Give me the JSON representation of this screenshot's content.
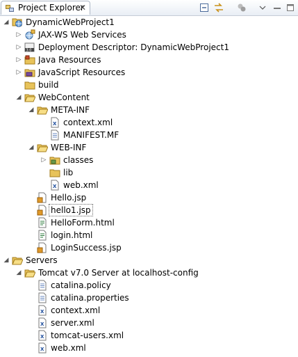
{
  "view": {
    "title": "Project Explorer",
    "close_glyph": "✕",
    "toolbar": [
      {
        "icon": "collapse-all-icon"
      },
      {
        "icon": "link-with-editor-icon"
      },
      {
        "icon": "view-menu-icon"
      },
      {
        "icon": "minimize-icon"
      },
      {
        "icon": "maximize-icon"
      }
    ]
  },
  "tree": [
    {
      "label": "DynamicWebProject1",
      "icon": "web-project-icon",
      "depth": 0,
      "expanded": true
    },
    {
      "label": "JAX-WS Web Services",
      "icon": "web-services-icon",
      "depth": 1,
      "expanded": false
    },
    {
      "label": "Deployment Descriptor: DynamicWebProject1",
      "icon": "deployment-descriptor-icon",
      "depth": 1,
      "expanded": false
    },
    {
      "label": "Java Resources",
      "icon": "java-resources-icon",
      "depth": 1,
      "expanded": false
    },
    {
      "label": "JavaScript Resources",
      "icon": "javascript-resources-icon",
      "depth": 1,
      "expanded": false
    },
    {
      "label": "build",
      "icon": "folder-icon",
      "depth": 1,
      "expanded": null
    },
    {
      "label": "WebContent",
      "icon": "open-folder-icon",
      "depth": 1,
      "expanded": true
    },
    {
      "label": "META-INF",
      "icon": "open-folder-icon",
      "depth": 2,
      "expanded": true
    },
    {
      "label": "context.xml",
      "icon": "xml-file-icon",
      "depth": 3,
      "expanded": null
    },
    {
      "label": "MANIFEST.MF",
      "icon": "text-file-icon",
      "depth": 3,
      "expanded": null
    },
    {
      "label": "WEB-INF",
      "icon": "open-folder-icon",
      "depth": 2,
      "expanded": true
    },
    {
      "label": "classes",
      "icon": "package-folder-icon",
      "depth": 3,
      "expanded": false
    },
    {
      "label": "lib",
      "icon": "folder-icon",
      "depth": 3,
      "expanded": null
    },
    {
      "label": "web.xml",
      "icon": "xml-file-icon",
      "depth": 3,
      "expanded": null
    },
    {
      "label": "Hello.jsp",
      "icon": "jsp-file-icon",
      "depth": 2,
      "expanded": null
    },
    {
      "label": "hello1.jsp",
      "icon": "jsp-file-icon",
      "depth": 2,
      "expanded": null,
      "selected": true
    },
    {
      "label": "HelloForm.html",
      "icon": "html-file-icon",
      "depth": 2,
      "expanded": null
    },
    {
      "label": "login.html",
      "icon": "html-file-icon",
      "depth": 2,
      "expanded": null
    },
    {
      "label": "LoginSuccess.jsp",
      "icon": "jsp-file-icon",
      "depth": 2,
      "expanded": null
    },
    {
      "label": "Servers",
      "icon": "open-folder-icon",
      "depth": 0,
      "expanded": true
    },
    {
      "label": "Tomcat v7.0 Server at localhost-config",
      "icon": "open-folder-icon",
      "depth": 1,
      "expanded": true
    },
    {
      "label": "catalina.policy",
      "icon": "text-file-icon",
      "depth": 2,
      "expanded": null
    },
    {
      "label": "catalina.properties",
      "icon": "text-file-icon",
      "depth": 2,
      "expanded": null
    },
    {
      "label": "context.xml",
      "icon": "xml-file-icon",
      "depth": 2,
      "expanded": null
    },
    {
      "label": "server.xml",
      "icon": "xml-file-icon",
      "depth": 2,
      "expanded": null
    },
    {
      "label": "tomcat-users.xml",
      "icon": "xml-file-icon",
      "depth": 2,
      "expanded": null
    },
    {
      "label": "web.xml",
      "icon": "xml-file-icon",
      "depth": 2,
      "expanded": null
    }
  ]
}
